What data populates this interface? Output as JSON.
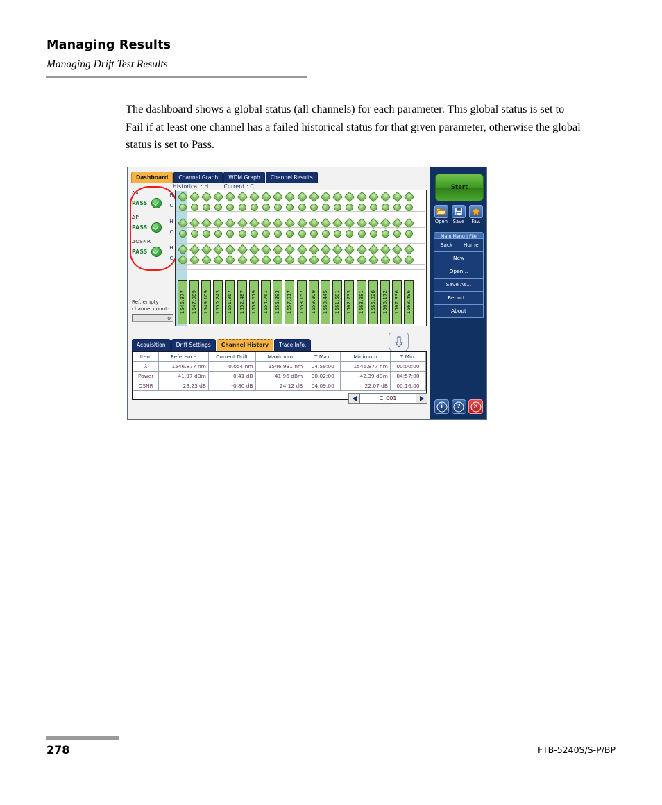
{
  "document": {
    "header_title": "Managing Results",
    "header_subtitle": "Managing Drift Test Results",
    "paragraph": "The dashboard shows a global status (all channels) for each parameter. This global status is set to Fail if at least one channel has a failed historical status for that given parameter, otherwise the global status is set to Pass.",
    "page_number": "278",
    "model": "FTB-5240S/S-P/BP"
  },
  "screenshot": {
    "top_tabs": [
      {
        "label": "Dashboard",
        "active": true
      },
      {
        "label": "Channel Graph",
        "active": false
      },
      {
        "label": "WDM Graph",
        "active": false
      },
      {
        "label": "Channel Results",
        "active": false
      }
    ],
    "legend": [
      "Historical : H",
      "Current : C"
    ],
    "status_panel": {
      "groups": [
        {
          "name": "Δλ",
          "status": "PASS",
          "icon": "check-circle-icon"
        },
        {
          "name": "ΔP",
          "status": "PASS",
          "icon": "check-circle-icon"
        },
        {
          "name": "ΔOSNR",
          "status": "PASS",
          "icon": "check-circle-icon"
        }
      ],
      "ref_empty_label_line1": "Ref. empty",
      "ref_empty_label_line2": "channel count:",
      "ref_empty_value": "0"
    },
    "grid": {
      "row_labels": [
        "H",
        "C"
      ],
      "channels": [
        "1546.877",
        "1547.989",
        "1549.109",
        "1550.243",
        "1551.367",
        "1552.487",
        "1553.619",
        "1554.761",
        "1555.893",
        "1557.017",
        "1558.157",
        "1559.309",
        "1560.445",
        "1561.581",
        "1562.733",
        "1563.881",
        "1565.028",
        "1566.172",
        "1567.336",
        "1568.496"
      ],
      "selected_channel_index": 0,
      "dot_status": "pass-green"
    },
    "bottom_tabs": [
      {
        "label": "Acquisition",
        "active": false
      },
      {
        "label": "Drift Settings",
        "active": false
      },
      {
        "label": "Channel History",
        "active": true
      },
      {
        "label": "Trace Info.",
        "active": false
      }
    ],
    "collapse_button_icon": "down-arrow-icon",
    "table": {
      "columns": [
        "Item",
        "Reference",
        "Current Drift",
        "Maximum",
        "T Max.",
        "Minimum",
        "T Min."
      ],
      "rows": [
        {
          "item": "λ",
          "reference": "1546.877 nm",
          "current_drift": "0.054 nm",
          "maximum": "1546.931 nm",
          "t_max": "04:59:00",
          "minimum": "1546.877 nm",
          "t_min": "00:00:00"
        },
        {
          "item": "Power",
          "reference": "-41.97 dBm",
          "current_drift": "-0.41 dB",
          "maximum": "-41.96 dBm",
          "t_max": "00:02:00",
          "minimum": "-42.39 dBm",
          "t_min": "04:57:00"
        },
        {
          "item": "OSNR",
          "reference": "23.23 dB",
          "current_drift": "-0.80 dB",
          "maximum": "24.12 dB",
          "t_max": "04:09:00",
          "minimum": "22.07 dB",
          "t_min": "00:16:00"
        }
      ]
    },
    "channel_nav": {
      "prev_icon": "triangle-left-icon",
      "next_icon": "triangle-right-icon",
      "current_channel": "C_001"
    },
    "sidebar": {
      "start_label": "Start",
      "quick_buttons": [
        {
          "label": "Open",
          "icon": "folder-open-icon"
        },
        {
          "label": "Save",
          "icon": "floppy-disk-icon"
        },
        {
          "label": "Fav.",
          "icon": "star-icon"
        }
      ],
      "menu_title": "Main Menu | File",
      "menu_items": [
        {
          "label": "Back",
          "half": true
        },
        {
          "label": "Home",
          "half": true
        },
        {
          "label": "New",
          "half": false
        },
        {
          "label": "Open...",
          "half": false
        },
        {
          "label": "Save As...",
          "half": false
        },
        {
          "label": "Report...",
          "half": false
        },
        {
          "label": "About",
          "half": false
        }
      ],
      "system_icons": [
        {
          "name": "info-icon",
          "glyph": "i"
        },
        {
          "name": "help-icon",
          "glyph": "?"
        },
        {
          "name": "close-icon",
          "glyph": "✕"
        }
      ]
    },
    "annotation": {
      "shape": "red-rounded-rectangle",
      "color": "#ee1c1c"
    }
  }
}
